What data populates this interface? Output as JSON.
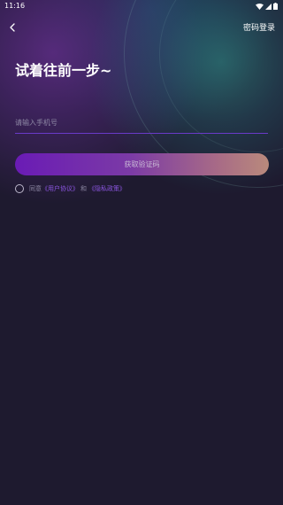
{
  "status_bar": {
    "time": "11:16"
  },
  "header": {
    "back_icon": "chevron-left-icon",
    "password_login_label": "密码登录"
  },
  "headline": "试着往前一步~",
  "phone_field": {
    "value": "",
    "placeholder": "请输入手机号"
  },
  "get_code_button_label": "获取验证码",
  "agreement": {
    "prefix": "同意",
    "user_agreement": "《用户协议》",
    "conjunction": "和",
    "privacy_policy": "《隐私政策》"
  },
  "colors": {
    "background": "#1e1a2f",
    "accent": "#8b55e0",
    "input_underline": "#6a3ac9",
    "button_gradient_start": "#6a1bb5",
    "button_gradient_end": "#b98a7c"
  }
}
